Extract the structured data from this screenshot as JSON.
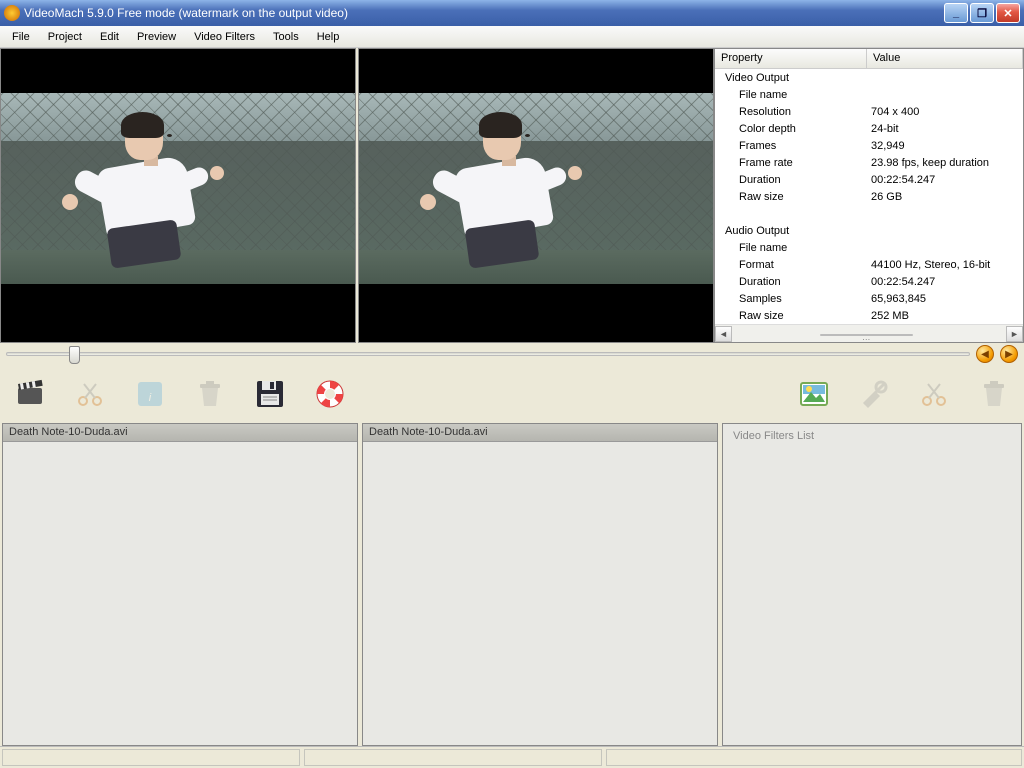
{
  "window": {
    "title": "VideoMach 5.9.0 Free mode (watermark on the output video)"
  },
  "menu": {
    "items": [
      "File",
      "Project",
      "Edit",
      "Preview",
      "Video Filters",
      "Tools",
      "Help"
    ]
  },
  "properties": {
    "header_property": "Property",
    "header_value": "Value",
    "rows": [
      {
        "k": "Video Output",
        "v": "",
        "section": true
      },
      {
        "k": "File name",
        "v": ""
      },
      {
        "k": "Resolution",
        "v": "704 x 400"
      },
      {
        "k": "Color depth",
        "v": "24-bit"
      },
      {
        "k": "Frames",
        "v": "32,949"
      },
      {
        "k": "Frame rate",
        "v": "23.98 fps, keep duration"
      },
      {
        "k": "Duration",
        "v": "00:22:54.247"
      },
      {
        "k": "Raw size",
        "v": "26 GB"
      },
      {
        "k": "",
        "v": ""
      },
      {
        "k": "Audio Output",
        "v": "",
        "section": true
      },
      {
        "k": "File name",
        "v": ""
      },
      {
        "k": "Format",
        "v": "44100 Hz, Stereo, 16-bit"
      },
      {
        "k": "Duration",
        "v": "00:22:54.247"
      },
      {
        "k": "Samples",
        "v": "65,963,845"
      },
      {
        "k": "Raw size",
        "v": "252 MB"
      }
    ]
  },
  "panels": {
    "left_title": "Death Note-10-Duda.avi",
    "mid_title": "Death Note-10-Duda.avi",
    "right_body": "Video Filters List"
  }
}
